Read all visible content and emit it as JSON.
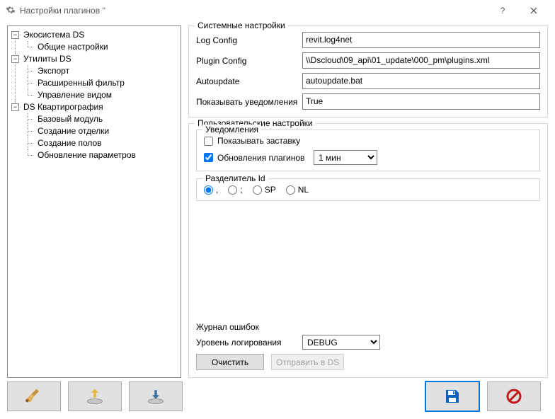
{
  "window": {
    "title": "Настройки плагинов ''"
  },
  "tree": {
    "n0": {
      "label": "Экосистема DS"
    },
    "n0_0": {
      "label": "Общие настройки"
    },
    "n1": {
      "label": "Утилиты DS"
    },
    "n1_0": {
      "label": "Экспорт"
    },
    "n1_1": {
      "label": "Расширенный фильтр"
    },
    "n1_2": {
      "label": "Управление видом"
    },
    "n2": {
      "label": "DS Квартирография"
    },
    "n2_0": {
      "label": "Базовый модуль"
    },
    "n2_1": {
      "label": "Создание отделки"
    },
    "n2_2": {
      "label": "Создание полов"
    },
    "n2_3": {
      "label": "Обновление параметров"
    }
  },
  "system": {
    "legend": "Системные настройки",
    "log_config_label": "Log Config",
    "log_config_value": "revit.log4net",
    "plugin_config_label": "Plugin Config",
    "plugin_config_value": "\\\\Dscloud\\09_api\\01_update\\000_pm\\plugins.xml",
    "autoupdate_label": "Autoupdate",
    "autoupdate_value": "autoupdate.bat",
    "show_notifications_label": "Показывать уведомления",
    "show_notifications_value": "True"
  },
  "user": {
    "legend": "Пользовательские настройки",
    "notifications_legend": "Уведомления",
    "splash_label": "Показывать заставку",
    "updates_label": "Обновления плагинов",
    "updates_interval": "1 мин",
    "separator_legend": "Разделитель Id",
    "sep_comma": ",",
    "sep_semicolon": ";",
    "sep_sp": "SP",
    "sep_nl": "NL",
    "errors_title": "Журнал ошибок",
    "log_level_label": "Уровень логирования",
    "log_level_value": "DEBUG",
    "clear_label": "Очистить",
    "send_label": "Отправить в DS"
  }
}
